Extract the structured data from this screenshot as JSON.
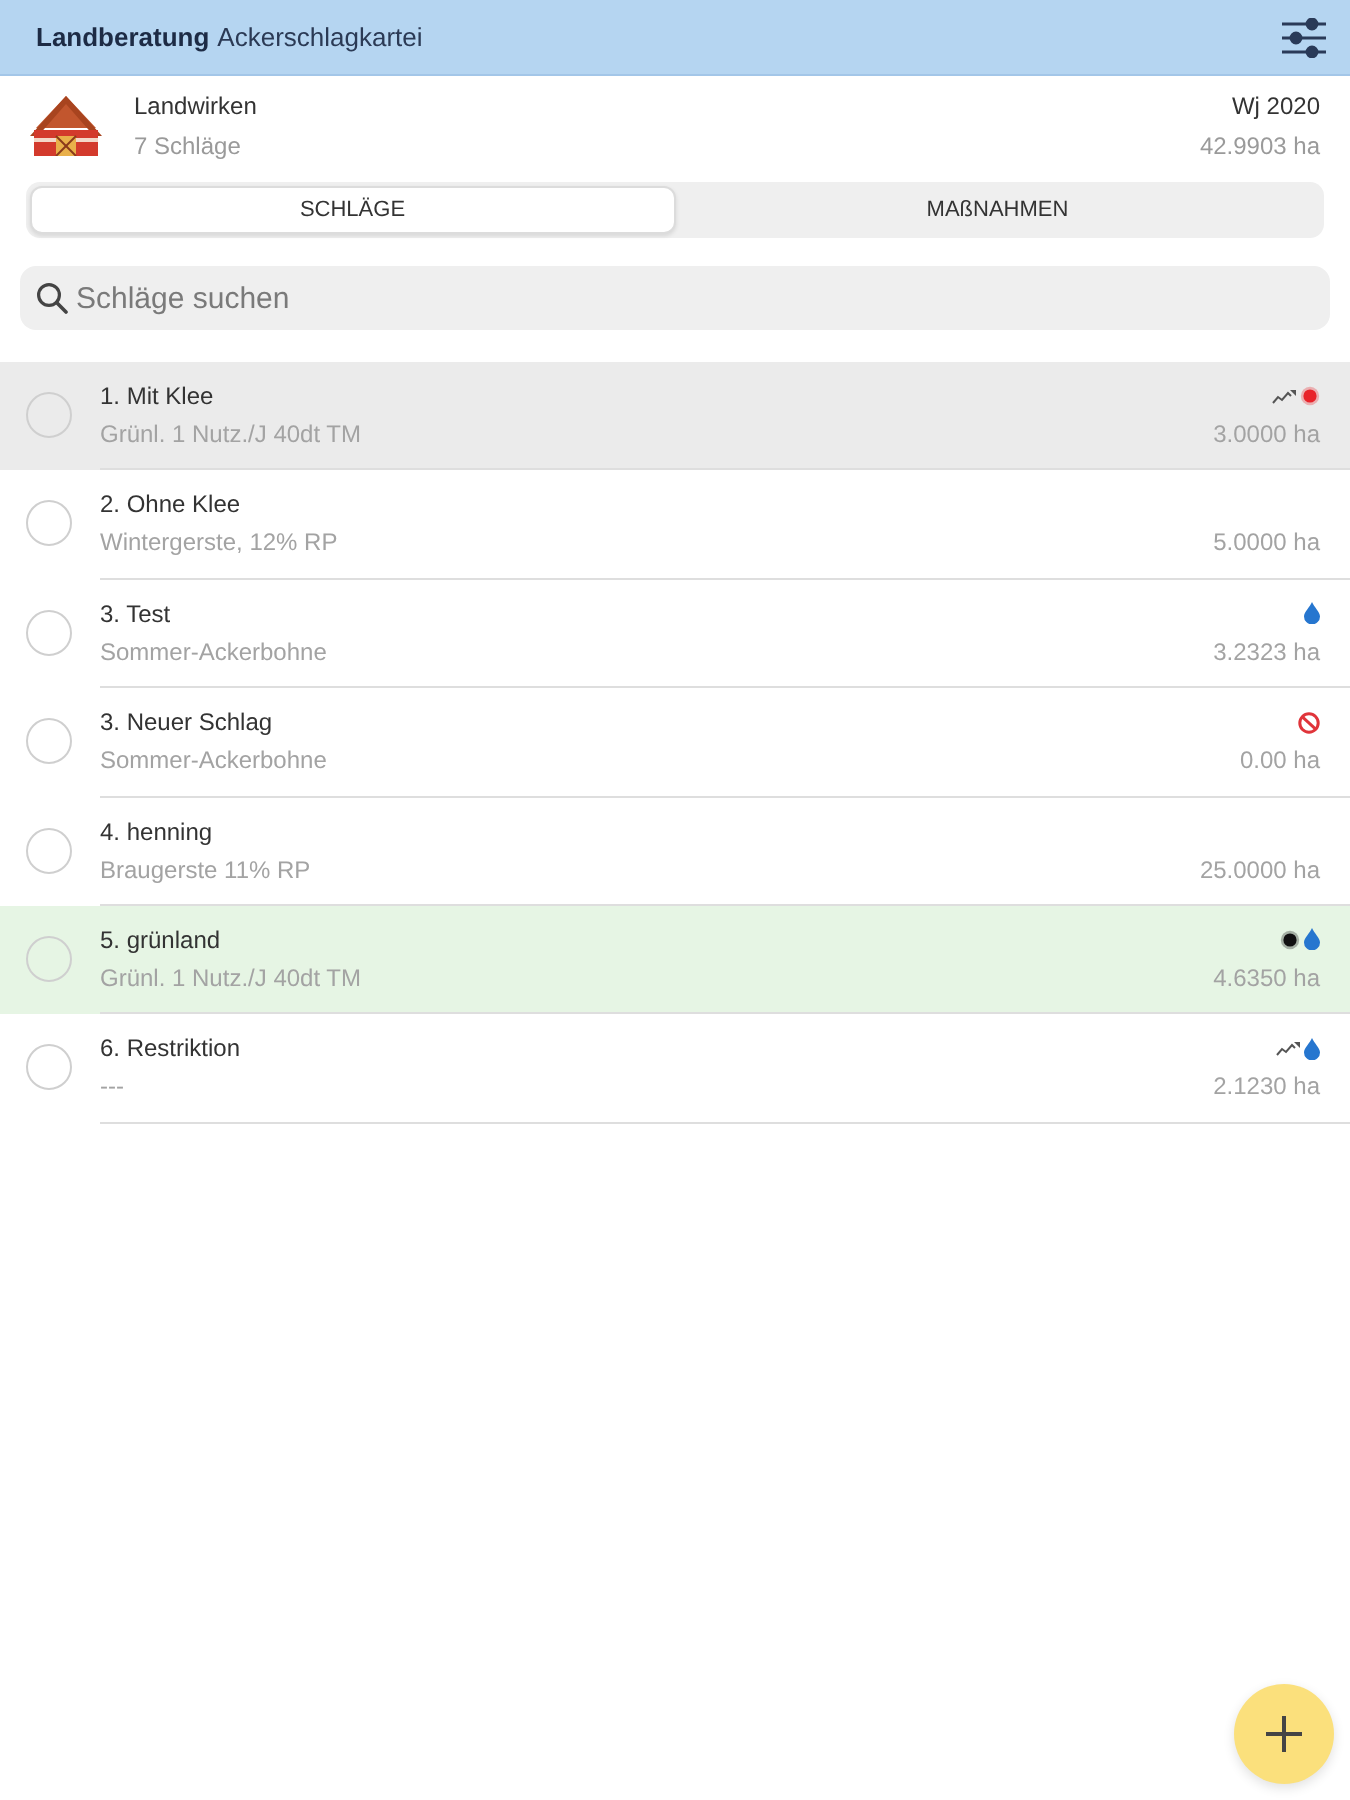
{
  "header": {
    "brand": "Landberatung",
    "title": "Ackerschlagkartei"
  },
  "farm": {
    "name": "Landwirken",
    "count": "7 Schläge",
    "year": "Wj 2020",
    "area": "42.9903 ha"
  },
  "tabs": [
    {
      "label": "SCHLÄGE",
      "selected": true
    },
    {
      "label": "MAßNAHMEN",
      "selected": false
    }
  ],
  "search": {
    "placeholder": "Schläge suchen"
  },
  "rows": [
    {
      "name": "1. Mit Klee",
      "crop": "Grünl. 1 Nutz./J 40dt TM",
      "area": "3.0000 ha",
      "checked": false,
      "selected": true,
      "highlighted": false,
      "icons": [
        {
          "kind": "trend"
        },
        {
          "kind": "dot",
          "color": "#e8232a"
        }
      ]
    },
    {
      "name": "2. Ohne Klee",
      "crop": "Wintergerste, 12% RP",
      "area": "5.0000 ha",
      "checked": false,
      "selected": false,
      "highlighted": false
    },
    {
      "name": "3. Test",
      "crop": "Sommer-Ackerbohne",
      "area": "3.2323 ha",
      "checked": false,
      "selected": false,
      "highlighted": false,
      "icons": [
        {
          "kind": "drop"
        }
      ]
    },
    {
      "name": "3. Neuer Schlag",
      "crop": "Sommer-Ackerbohne",
      "area": "0.00 ha",
      "checked": false,
      "selected": false,
      "highlighted": false,
      "icons": [
        {
          "kind": "forbidden"
        }
      ]
    },
    {
      "name": "4. henning",
      "crop": "Braugerste 11% RP",
      "area": "25.0000 ha",
      "checked": false,
      "selected": false,
      "highlighted": false
    },
    {
      "name": "5. grünland",
      "crop": "Grünl. 1 Nutz./J 40dt TM",
      "area": "4.6350 ha",
      "checked": false,
      "selected": false,
      "highlighted": true,
      "icons": [
        {
          "kind": "dot",
          "color": "#111111"
        },
        {
          "kind": "drop"
        }
      ]
    },
    {
      "name": "6. Restriktion",
      "crop": "---",
      "area": "2.1230 ha",
      "checked": false,
      "selected": false,
      "highlighted": false,
      "icons": [
        {
          "kind": "trend"
        },
        {
          "kind": "drop"
        }
      ]
    }
  ]
}
